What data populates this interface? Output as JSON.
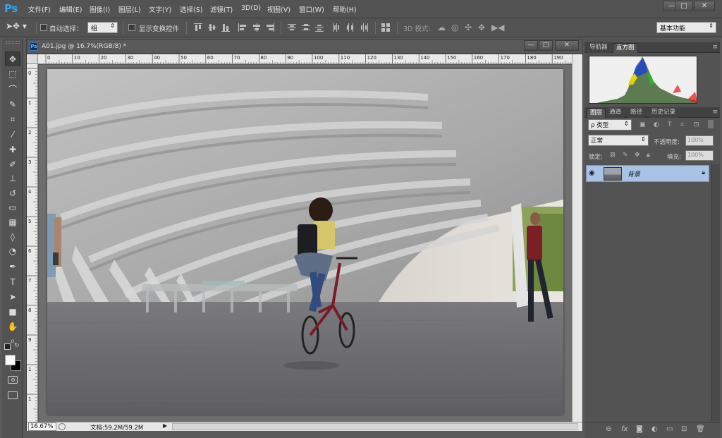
{
  "app": {
    "logo": "Ps",
    "menu": [
      "文件(F)",
      "编辑(E)",
      "图像(I)",
      "图层(L)",
      "文字(Y)",
      "选择(S)",
      "滤镜(T)",
      "3D(D)",
      "视图(V)",
      "窗口(W)",
      "帮助(H)"
    ],
    "window_buttons": {
      "minimize": "—",
      "maximize": "□",
      "close": "✕"
    }
  },
  "options": {
    "auto_select_label": "自动选择：",
    "auto_select_value": "组",
    "show_transform_label": "显示变换控件",
    "mode3d_label": "3D 模式:",
    "workspace": "基本功能"
  },
  "tools": [
    {
      "name": "move-tool",
      "glyph": "✥"
    },
    {
      "name": "marquee-tool",
      "glyph": "⬚"
    },
    {
      "name": "lasso-tool",
      "glyph": "⌒"
    },
    {
      "name": "quick-select-tool",
      "glyph": "✎"
    },
    {
      "name": "crop-tool",
      "glyph": "⌗"
    },
    {
      "name": "eyedropper-tool",
      "glyph": "⁄"
    },
    {
      "name": "healing-brush-tool",
      "glyph": "✚"
    },
    {
      "name": "brush-tool",
      "glyph": "✐"
    },
    {
      "name": "clone-stamp-tool",
      "glyph": "⊥"
    },
    {
      "name": "history-brush-tool",
      "glyph": "↺"
    },
    {
      "name": "eraser-tool",
      "glyph": "▭"
    },
    {
      "name": "gradient-tool",
      "glyph": "▦"
    },
    {
      "name": "blur-tool",
      "glyph": "◊"
    },
    {
      "name": "dodge-tool",
      "glyph": "◔"
    },
    {
      "name": "pen-tool",
      "glyph": "✒"
    },
    {
      "name": "type-tool",
      "glyph": "T"
    },
    {
      "name": "path-select-tool",
      "glyph": "➤"
    },
    {
      "name": "shape-tool",
      "glyph": "■"
    },
    {
      "name": "hand-tool",
      "glyph": "✋"
    },
    {
      "name": "zoom-tool",
      "glyph": "⌕"
    }
  ],
  "document": {
    "title": "A01.jpg @ 16.7%(RGB/8) *",
    "ps_badge": "Ps",
    "ruler_top": [
      "0",
      "10",
      "20",
      "30",
      "40",
      "50",
      "60",
      "70",
      "80",
      "90",
      "100",
      "110",
      "120",
      "130",
      "140",
      "150",
      "160",
      "170",
      "180",
      "190"
    ],
    "ruler_left": [
      "0",
      "1",
      "2",
      "3",
      "4",
      "5",
      "6",
      "7",
      "8",
      "9",
      "1",
      "1"
    ],
    "zoom": "16.67%",
    "doc_info": "文档:59.2M/59.2M"
  },
  "panels": {
    "top_tabs": [
      "导航器",
      "直方图"
    ],
    "top_active": 1,
    "layer_tabs": [
      "图层",
      "通道",
      "路径",
      "历史记录"
    ],
    "layer_active": 0,
    "filter_label": "ρ 类型",
    "blend_mode": "正常",
    "opacity_label": "不透明度:",
    "opacity_value": "100%",
    "lock_label": "锁定:",
    "fill_label": "填充:",
    "fill_value": "100%",
    "layer_name": "背景"
  }
}
